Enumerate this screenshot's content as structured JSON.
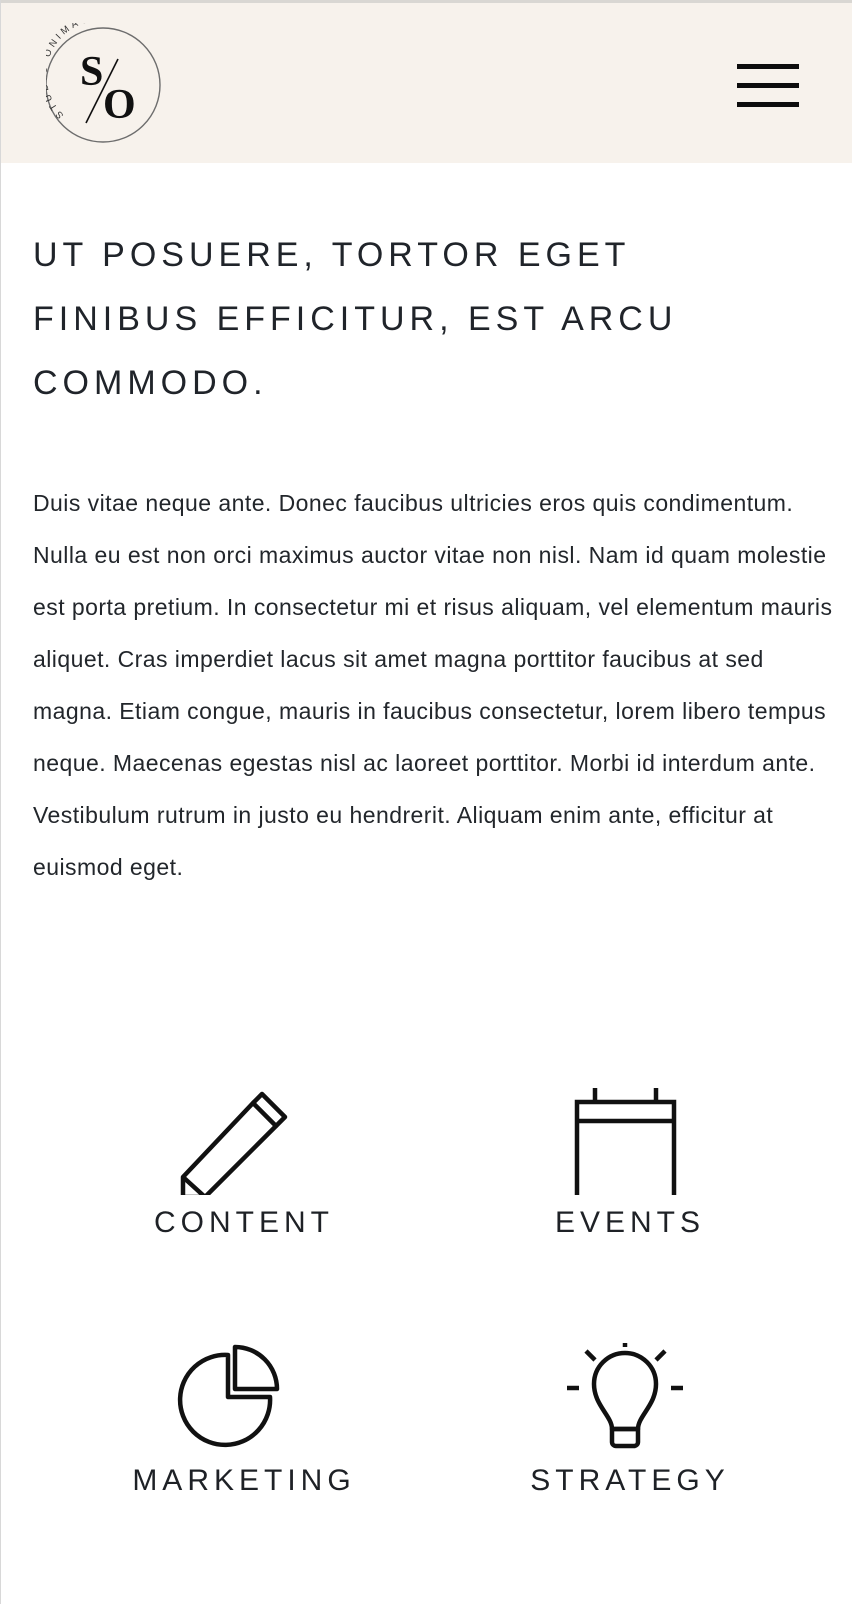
{
  "header": {
    "logo_arc_text": "STUDIO ONIMAGE",
    "logo_monogram_s": "S",
    "logo_monogram_o": "O",
    "menu_icon": "hamburger-menu-icon",
    "background_color": "#f7f2ec"
  },
  "main": {
    "headline": "UT POSUERE, TORTOR EGET FINIBUS EFFICITUR, EST ARCU COMMODO.",
    "paragraph": "Duis vitae neque ante. Donec faucibus ultricies eros quis condimentum. Nulla eu est non orci maximus auctor vitae non nisl. Nam id quam molestie est porta pretium. In consectetur mi et risus aliquam, vel elementum mauris aliquet. Cras imperdiet lacus sit amet magna porttitor faucibus at sed magna. Etiam congue, mauris in faucibus consectetur, lorem libero tempus neque. Maecenas egestas nisl ac laoreet porttitor. Morbi id interdum ante. Vestibulum rutrum in justo eu hendrerit. Aliquam enim ante, efficitur at euismod eget."
  },
  "services": [
    {
      "label": "CONTENT",
      "icon": "pencil-icon"
    },
    {
      "label": "EVENTS",
      "icon": "calendar-icon"
    },
    {
      "label": "MARKETING",
      "icon": "pie-chart-icon"
    },
    {
      "label": "STRATEGY",
      "icon": "lightbulb-icon"
    }
  ]
}
